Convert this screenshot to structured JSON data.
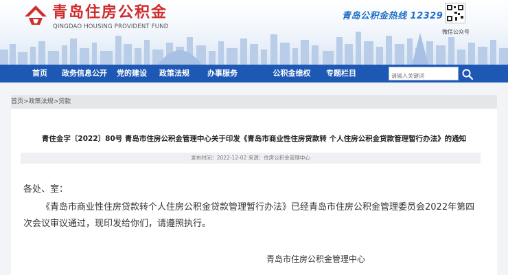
{
  "header": {
    "logo_cn": "青岛住房公积金",
    "logo_en": "QINGDAO HOUSING PROVIDENT FUND",
    "hotline": "青岛公积金热线 12329",
    "qr_label": "微信公众号"
  },
  "nav": {
    "items": [
      "首页",
      "政务信息公开",
      "党的建设",
      "政策法规",
      "办事服务",
      "公积金维权",
      "专题栏目"
    ],
    "search_placeholder": "请输入关键词"
  },
  "breadcrumb": {
    "items": [
      "首页",
      "政策法规",
      "贷款"
    ],
    "separator": ">"
  },
  "article": {
    "title": "青住金字〔2022〕80号 青岛市住房公积金管理中心关于印发《青岛市商业性住房贷款转 个人住房公积金贷款管理暂行办法》的通知",
    "meta": "发布时间：2022-12-02 来源：住房公积金管理中心",
    "greeting": "各处、室：",
    "body": "《青岛市商业性住房贷款转个人住房公积金贷款管理暂行办法》已经青岛市住房公积金管理委员会2022年第四次会议审议通过，现印发给你们，请遵照执行。",
    "signature": "青岛市住房公积金管理中心"
  },
  "colors": {
    "nav_bg": "#1d58b5",
    "logo_red": "#d02c2c",
    "hotline_blue": "#1f6ec6",
    "page_bg": "#f2f4f7"
  }
}
